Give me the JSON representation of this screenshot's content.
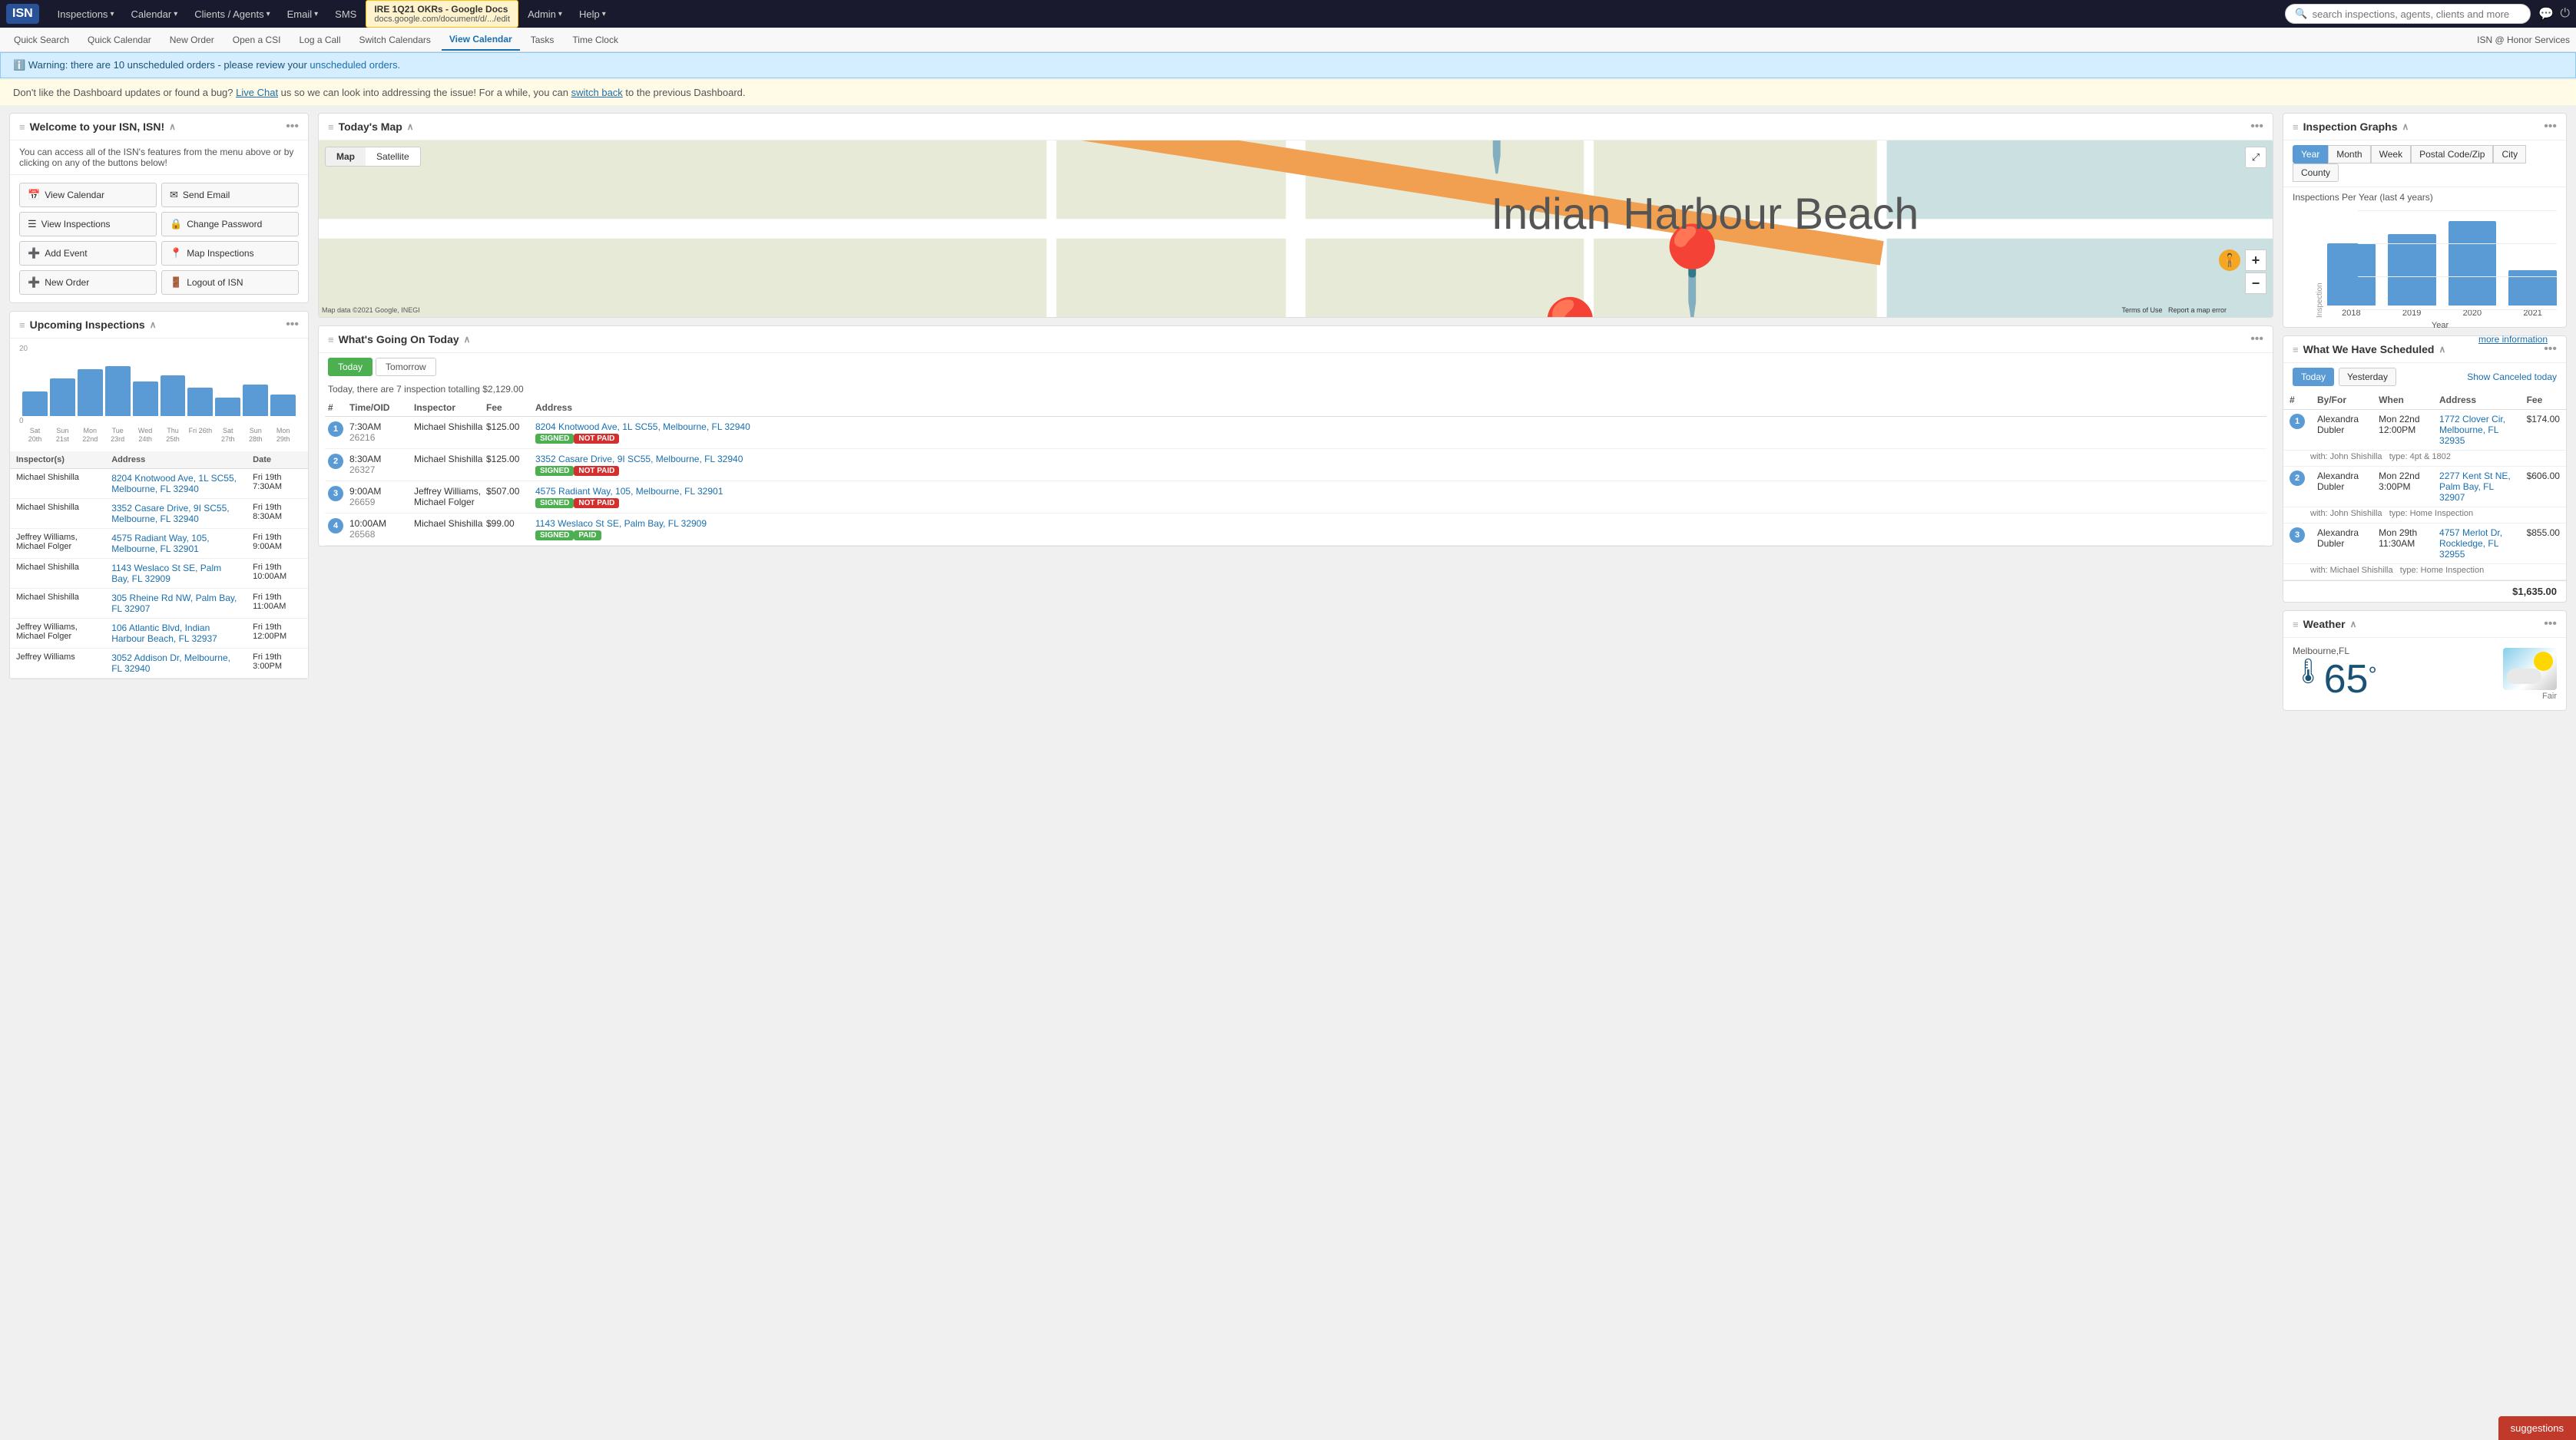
{
  "app": {
    "logo": "ISN",
    "nav": {
      "items": [
        {
          "label": "Inspections",
          "arrow": "▾"
        },
        {
          "label": "Calendar",
          "arrow": "▾"
        },
        {
          "label": "Clients / Agents",
          "arrow": "▾"
        },
        {
          "label": "Email",
          "arrow": "▾"
        },
        {
          "label": "SMS"
        },
        {
          "label": "Admin",
          "arrow": "▾"
        },
        {
          "label": "Help",
          "arrow": "▾"
        }
      ],
      "google_doc": {
        "title": "IRE 1Q21 OKRs - Google Docs",
        "url": "docs.google.com/document/d/.../edit"
      }
    },
    "search_placeholder": "search inspections, agents, clients and more",
    "second_nav": [
      {
        "label": "Quick Search"
      },
      {
        "label": "Quick Calendar"
      },
      {
        "label": "New Order"
      },
      {
        "label": "Open a CSI"
      },
      {
        "label": "Log a Call"
      },
      {
        "label": "Switch Calendars"
      },
      {
        "label": "View Calendar",
        "active": true
      },
      {
        "label": "Tasks"
      },
      {
        "label": "Time Clock"
      }
    ],
    "isn_label": "ISN @ Honor Services"
  },
  "alerts": {
    "warning": "Warning: there are 10 unscheduled orders - please review your unscheduled orders.",
    "info_pre": "Don't like the Dashboard updates or found a bug?",
    "info_chat": "Live Chat",
    "info_mid": "us so we can look into addressing the issue! For a while, you can",
    "info_back": "switch back",
    "info_post": "to the previous Dashboard."
  },
  "welcome": {
    "title": "Welcome to your ISN, ISN!",
    "desc": "You can access all of the ISN's features from the menu above or by clicking on any of the buttons below!",
    "buttons": [
      {
        "icon": "📅",
        "label": "View Calendar"
      },
      {
        "icon": "✉",
        "label": "Send Email"
      },
      {
        "icon": "☰",
        "label": "View Inspections"
      },
      {
        "icon": "🔒",
        "label": "Change Password"
      },
      {
        "icon": "➕",
        "label": "Add Event"
      },
      {
        "icon": "📍",
        "label": "Map Inspections"
      },
      {
        "icon": "➕",
        "label": "New Order"
      },
      {
        "icon": "🚪",
        "label": "Logout of ISN"
      }
    ]
  },
  "upcoming": {
    "title": "Upcoming Inspections",
    "chart": {
      "bars": [
        40,
        60,
        75,
        80,
        55,
        65,
        45,
        30,
        50,
        35
      ],
      "labels": [
        "Sat 20th",
        "Sun 21st",
        "Mon 22nd",
        "Tue 23rd",
        "Wed 24th",
        "Thu 25th",
        "Fri 26th",
        "Sat 27th",
        "Sun 28th",
        "Mon 29th"
      ]
    },
    "y_max": 20,
    "y_zero": 0,
    "headers": [
      "Inspector(s)",
      "Address",
      "Date"
    ],
    "rows": [
      {
        "inspector": "Michael Shishilla",
        "address": "8204 Knotwood Ave, 1L SC55, Melbourne, FL 32940",
        "date": "Fri 19th 7:30AM"
      },
      {
        "inspector": "Michael Shishilla",
        "address": "3352 Casare Drive, 9I SC55, Melbourne, FL 32940",
        "date": "Fri 19th 8:30AM"
      },
      {
        "inspector": "Jeffrey Williams, Michael Folger",
        "address": "4575 Radiant Way, 105, Melbourne, FL 32901",
        "date": "Fri 19th 9:00AM"
      },
      {
        "inspector": "Michael Shishilla",
        "address": "1143 Weslaco St SE, Palm Bay, FL 32909",
        "date": "Fri 19th 10:00AM"
      },
      {
        "inspector": "Michael Shishilla",
        "address": "305 Rheine Rd NW, Palm Bay, FL 32907",
        "date": "Fri 19th 11:00AM"
      },
      {
        "inspector": "Jeffrey Williams, Michael Folger",
        "address": "106 Atlantic Blvd, Indian Harbour Beach, FL 32937",
        "date": "Fri 19th 12:00PM"
      },
      {
        "inspector": "Jeffrey Williams",
        "address": "3052 Addison Dr, Melbourne, FL 32940",
        "date": "Fri 19th 3:00PM"
      }
    ]
  },
  "todays_map": {
    "title": "Today's Map",
    "tabs": [
      "Map",
      "Satellite"
    ],
    "active_tab": "Map",
    "attribution": "Map data ©2021 Google, INEGI",
    "terms": "Terms of Use",
    "report": "Report a map error"
  },
  "whats_going_on": {
    "title": "What's Going On Today",
    "tabs": [
      "Today",
      "Tomorrow"
    ],
    "active_tab": "Today",
    "summary": "Today, there are 7 inspection totalling $2,129.00",
    "headers": [
      "#",
      "Time/OID",
      "Inspector",
      "Fee",
      "Address"
    ],
    "rows": [
      {
        "num": 1,
        "time": "7:30AM",
        "oid": "26216",
        "inspector": "Michael Shishilla",
        "fee": "$125.00",
        "address": "8204 Knotwood Ave, 1L SC55, Melbourne, FL 32940",
        "badges": [
          "SIGNED",
          "NOT PAID"
        ]
      },
      {
        "num": 2,
        "time": "8:30AM",
        "oid": "26327",
        "inspector": "Michael Shishilla",
        "fee": "$125.00",
        "address": "3352 Casare Drive, 9I SC55, Melbourne, FL 32940",
        "badges": [
          "SIGNED",
          "NOT PAID"
        ]
      },
      {
        "num": 3,
        "time": "9:00AM",
        "oid": "26659",
        "inspector": "Jeffrey Williams, Michael Folger",
        "fee": "$507.00",
        "address": "4575 Radiant Way, 105, Melbourne, FL 32901",
        "badges": [
          "SIGNED",
          "NOT PAID"
        ]
      },
      {
        "num": 4,
        "time": "10:00AM",
        "oid": "26568",
        "inspector": "Michael Shishilla",
        "fee": "$99.00",
        "address": "1143 Weslaco St SE, Palm Bay, FL 32909",
        "badges": [
          "SIGNED",
          "PAID"
        ]
      }
    ]
  },
  "inspection_graphs": {
    "title": "Inspection Graphs",
    "tabs": [
      "Year",
      "Month",
      "Week",
      "Postal Code/Zip",
      "City",
      "County"
    ],
    "active_tab": "Year",
    "chart_title": "Inspections Per Year (last 4 years)",
    "x_axis_label": "Year",
    "y_axis_label": "Inspection",
    "bars": [
      {
        "year": "2018",
        "height": 70
      },
      {
        "year": "2019",
        "height": 80
      },
      {
        "year": "2020",
        "height": 95
      },
      {
        "year": "2021",
        "height": 40
      }
    ],
    "more_info": "more information"
  },
  "scheduled": {
    "title": "What We Have Scheduled",
    "tabs": [
      "Today",
      "Yesterday"
    ],
    "active_tab": "Today",
    "show_cancel": "Show Canceled today",
    "headers": [
      "#",
      "By/For",
      "When",
      "Address",
      "Fee"
    ],
    "rows": [
      {
        "num": 1,
        "byfor": "Alexandra Dubler",
        "when": "Mon 22nd 12:00PM",
        "address": "1772 Clover Cir, Melbourne, FL 32935",
        "fee": "$174.00",
        "with": "John Shishilla",
        "type": "4pt & 1802"
      },
      {
        "num": 2,
        "byfor": "Alexandra Dubler",
        "when": "Mon 22nd 3:00PM",
        "address": "2277 Kent St NE, Palm Bay, FL 32907",
        "fee": "$606.00",
        "with": "John Shishilla",
        "type": "Home Inspection"
      },
      {
        "num": 3,
        "byfor": "Alexandra Dubler",
        "when": "Mon 29th 11:30AM",
        "address": "4757 Merlot Dr, Rockledge, FL 32955",
        "fee": "$855.00",
        "with": "Michael Shishilla",
        "type": "Home Inspection"
      }
    ],
    "total": "$1,635.00"
  },
  "weather": {
    "title": "Weather",
    "location": "Melbourne,FL",
    "condition": "Fair",
    "temp": "65",
    "temp_symbol": "°"
  },
  "suggestions_btn": "suggestions"
}
